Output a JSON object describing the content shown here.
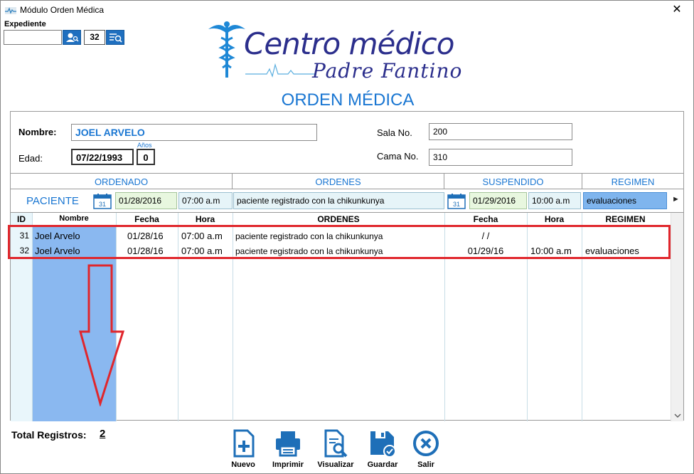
{
  "window": {
    "title": "Módulo Orden Médica",
    "close": "✕"
  },
  "expediente": {
    "label": "Expediente",
    "value": "",
    "number": "32"
  },
  "logo": {
    "line1": "Centro médico",
    "line2": "Padre Fantino"
  },
  "page_title": "ORDEN MÉDICA",
  "patient": {
    "nombre_label": "Nombre:",
    "nombre": "JOEL ARVELO",
    "edad_label": "Edad:",
    "fecha_nac": "07/22/1993",
    "anos_label": "Años",
    "anos": "0",
    "sala_label": "Sala No.",
    "sala": "200",
    "cama_label": "Cama No.",
    "cama": "310"
  },
  "sections": {
    "ordenado": "ORDENADO",
    "ordenes": "ORDENES",
    "suspendido": "SUSPENDIDO",
    "regimen": "REGIMEN"
  },
  "entry": {
    "paciente": "PACIENTE",
    "fecha": "01/28/2016",
    "hora": "07:00 a.m",
    "orden": "paciente registrado con la chikunkunya",
    "susp_fecha": "01/29/2016",
    "susp_hora": "10:00 a.m",
    "regimen": "evaluaciones",
    "nav": "►"
  },
  "columns": {
    "id": "ID",
    "nombre": "Nombre",
    "fecha": "Fecha",
    "hora": "Hora",
    "ordenes": "ORDENES",
    "fecha2": "Fecha",
    "hora2": "Hora",
    "regimen": "REGIMEN"
  },
  "rows": [
    {
      "id": "31",
      "nombre": "Joel Arvelo",
      "fecha": "01/28/16",
      "hora": "07:00 a.m",
      "orden": "paciente registrado con la chikunkunya",
      "susp_fecha": "/ /",
      "susp_hora": "",
      "regimen": ""
    },
    {
      "id": "32",
      "nombre": "Joel Arvelo",
      "fecha": "01/28/16",
      "hora": "07:00 a.m",
      "orden": "paciente registrado con la chikunkunya",
      "susp_fecha": "01/29/16",
      "susp_hora": "10:00 a.m",
      "regimen": "evaluaciones"
    }
  ],
  "total": {
    "label": "Total Registros:",
    "value": "2"
  },
  "toolbar": {
    "nuevo": "Nuevo",
    "imprimir": "Imprimir",
    "visualizar": "Visualizar",
    "guardar": "Guardar",
    "salir": "Salir"
  },
  "colors": {
    "accent": "#1976d2",
    "highlight": "#e0262c",
    "selected_column": "#8ab8f0"
  }
}
